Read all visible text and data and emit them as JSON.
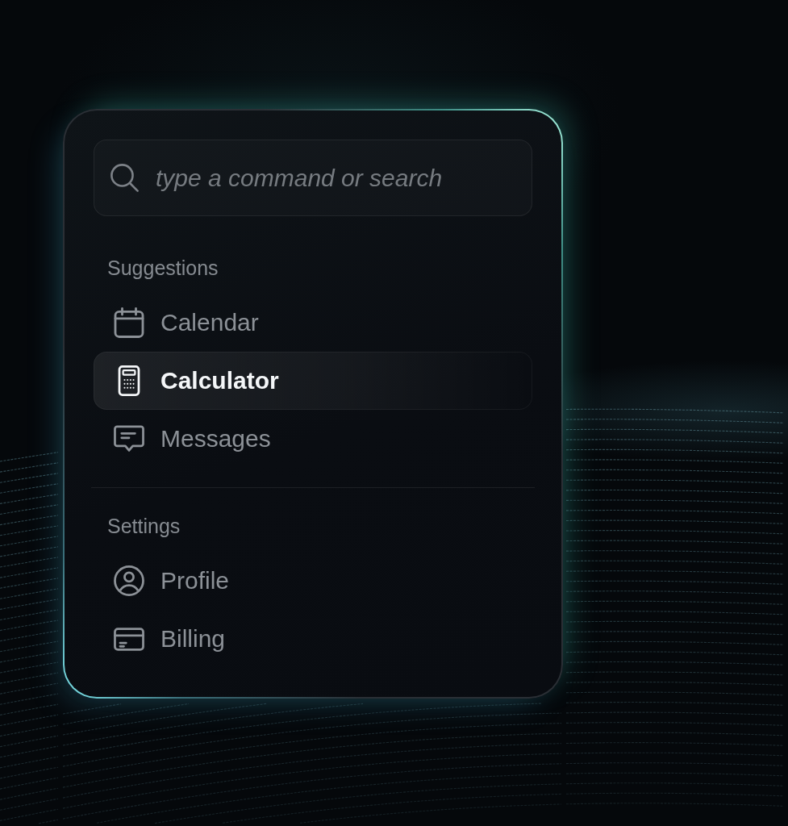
{
  "search": {
    "placeholder": "type a command or search"
  },
  "groups": [
    {
      "heading": "Suggestions",
      "items": [
        {
          "label": "Calendar",
          "selected": false
        },
        {
          "label": "Calculator",
          "selected": true
        },
        {
          "label": "Messages",
          "selected": false
        }
      ]
    },
    {
      "heading": "Settings",
      "items": [
        {
          "label": "Profile",
          "selected": false
        },
        {
          "label": "Billing",
          "selected": false
        }
      ]
    }
  ]
}
